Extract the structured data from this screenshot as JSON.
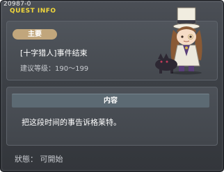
{
  "window": {
    "quest_id": "20987-0",
    "title": "QUEST INFO"
  },
  "quest": {
    "category_tag": "主要",
    "name": "[十字猎人]事件结束",
    "level": "建议等级：190～199"
  },
  "npc": {
    "icon": "npc-portrait-top-hat-with-wolf"
  },
  "content": {
    "header": "内容",
    "text": "把这段时间的事告诉格莱特。"
  },
  "status": {
    "text": "狀態： 可開始"
  },
  "colors": {
    "title": "#f3d93a",
    "tag_bg": "#c1a67c",
    "header_bg": "#5c6a73",
    "window_bg": "#3d4147"
  }
}
